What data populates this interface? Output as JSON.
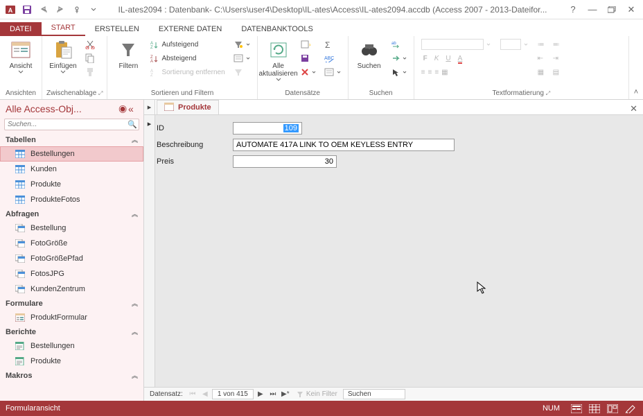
{
  "titlebar": {
    "title": "IL-ates2094 : Datenbank- C:\\Users\\user4\\Desktop\\IL-ates\\Access\\IL-ates2094.accdb (Access 2007 - 2013-Dateifor..."
  },
  "tabs": {
    "file": "DATEI",
    "start": "START",
    "create": "ERSTELLEN",
    "external": "EXTERNE DATEN",
    "dbtools": "DATENBANKTOOLS"
  },
  "ribbon": {
    "views": {
      "label": "Ansichten",
      "ansicht": "Ansicht"
    },
    "clipboard": {
      "label": "Zwischenablage",
      "paste": "Einfügen"
    },
    "sortfilter": {
      "label": "Sortieren und Filtern",
      "filter": "Filtern",
      "asc": "Aufsteigend",
      "desc": "Absteigend",
      "clear": "Sortierung entfernen"
    },
    "records": {
      "label": "Datensätze",
      "refresh": "Alle\naktualisieren"
    },
    "find": {
      "label": "Suchen",
      "find_btn": "Suchen"
    },
    "textfmt": {
      "label": "Textformatierung"
    }
  },
  "nav": {
    "header": "Alle Access-Obj...",
    "search_placeholder": "Suchen...",
    "cat_tables": "Tabellen",
    "cat_queries": "Abfragen",
    "cat_forms": "Formulare",
    "cat_reports": "Berichte",
    "cat_macros": "Makros",
    "tables": [
      "Bestellungen",
      "Kunden",
      "Produkte",
      "ProdukteFotos"
    ],
    "queries": [
      "Bestellung",
      "FotoGröße",
      "FotoGrößePfad",
      "FotosJPG",
      "KundenZentrum"
    ],
    "forms": [
      "ProduktFormular"
    ],
    "reports": [
      "Bestellungen",
      "Produkte"
    ]
  },
  "doc": {
    "tab": "Produkte",
    "fields": {
      "id_label": "ID",
      "id_value": "109",
      "desc_label": "Beschreibung",
      "desc_value": "AUTOMATE 417A LINK TO OEM KEYLESS ENTRY",
      "price_label": "Preis",
      "price_value": "30"
    }
  },
  "recnav": {
    "label": "Datensatz:",
    "pos": "1 von 415",
    "filter": "Kein Filter",
    "search": "Suchen"
  },
  "status": {
    "view": "Formularansicht",
    "num": "NUM"
  }
}
